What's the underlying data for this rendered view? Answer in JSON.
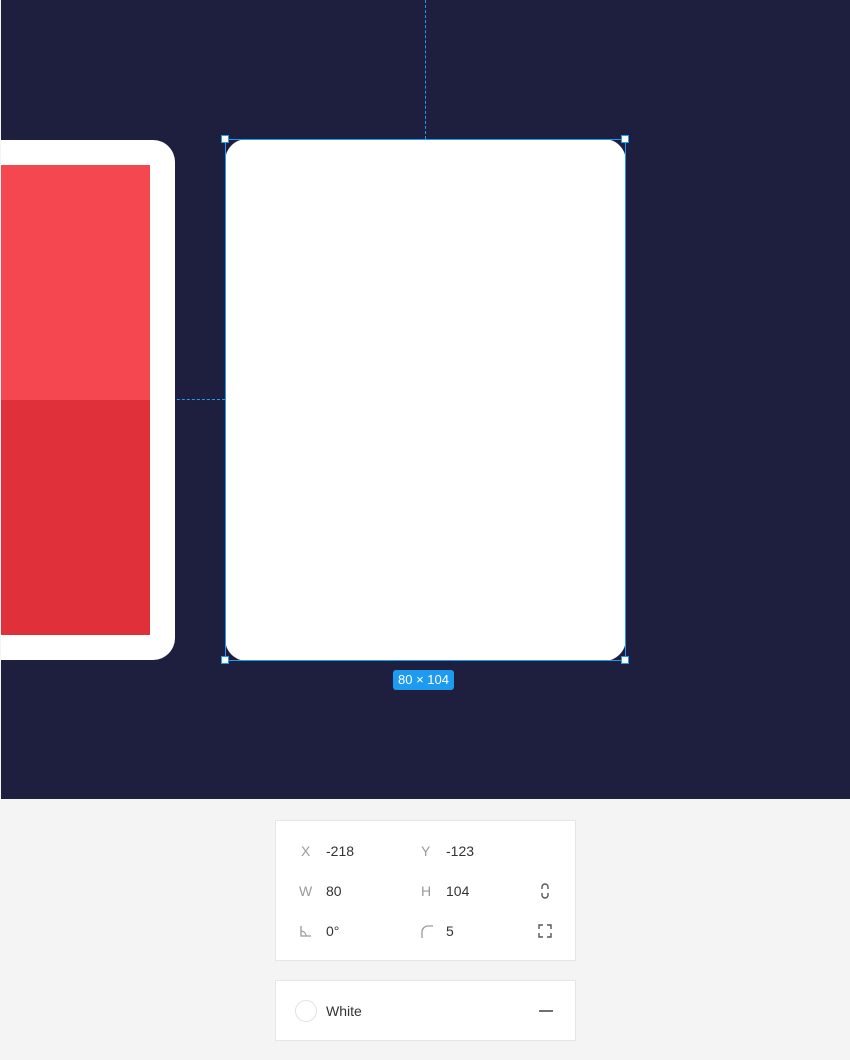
{
  "canvas": {
    "background": "#1e1f3f",
    "selection_color": "#1e9bf0",
    "selected_size_label": "80 × 104",
    "left_card_colors": {
      "top": "#f5474f",
      "bottom": "#e0313a"
    }
  },
  "properties": {
    "x_label": "X",
    "x_value": "-218",
    "y_label": "Y",
    "y_value": "-123",
    "w_label": "W",
    "w_value": "80",
    "h_label": "H",
    "h_value": "104",
    "rotation_value": "0°",
    "radius_value": "5",
    "rotation_icon": "angle-icon",
    "radius_icon": "corner-radius-icon",
    "constrain_icon": "constrain-proportions-icon",
    "independent_corners_icon": "independent-corners-icon"
  },
  "fill": {
    "color_name": "White",
    "color": "#ffffff",
    "remove_icon": "minus-icon"
  }
}
